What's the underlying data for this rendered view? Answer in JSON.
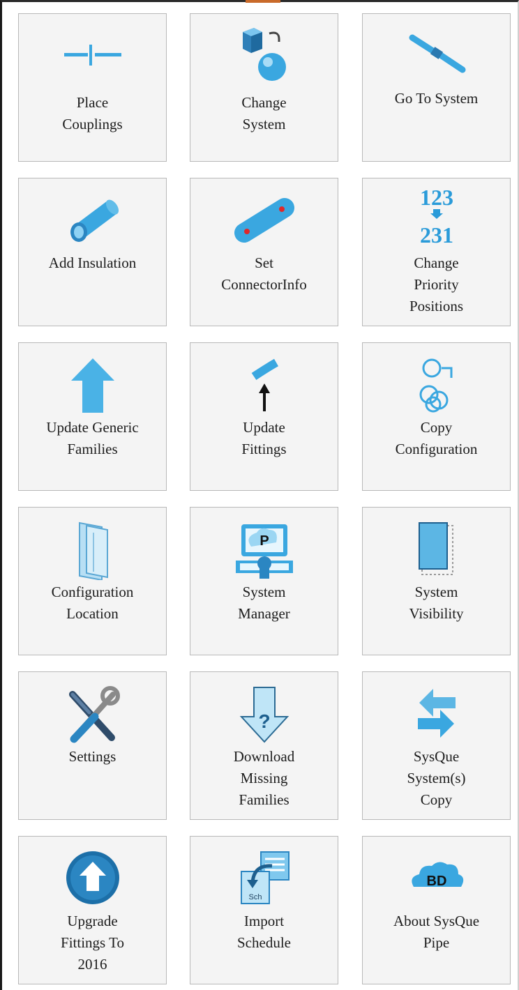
{
  "panel": {
    "tiles": [
      {
        "label": "Place\nCouplings",
        "icon": "place-couplings-icon"
      },
      {
        "label": "Change\nSystem",
        "icon": "change-system-icon"
      },
      {
        "label": "Go To System",
        "icon": "go-to-system-icon"
      },
      {
        "label": "Add Insulation",
        "icon": "add-insulation-icon"
      },
      {
        "label": "Set\nConnectorInfo",
        "icon": "set-connector-info-icon"
      },
      {
        "label": "Change\nPriority\nPositions",
        "icon": "change-priority-icon",
        "icon_text_top": "123",
        "icon_text_bottom": "231"
      },
      {
        "label": "Update Generic\nFamilies",
        "icon": "update-generic-families-icon"
      },
      {
        "label": "Update\nFittings",
        "icon": "update-fittings-icon"
      },
      {
        "label": "Copy\nConfiguration",
        "icon": "copy-configuration-icon"
      },
      {
        "label": "Configuration\nLocation",
        "icon": "configuration-location-icon"
      },
      {
        "label": "System\nManager",
        "icon": "system-manager-icon",
        "icon_text": "P"
      },
      {
        "label": "System\nVisibility",
        "icon": "system-visibility-icon"
      },
      {
        "label": "Settings",
        "icon": "settings-icon"
      },
      {
        "label": "Download\nMissing\nFamilies",
        "icon": "download-missing-families-icon"
      },
      {
        "label": "SysQue\nSystem(s)\nCopy",
        "icon": "sysque-systems-copy-icon"
      },
      {
        "label": "Upgrade\nFittings To\n2016",
        "icon": "upgrade-fittings-icon"
      },
      {
        "label": "Import\nSchedule",
        "icon": "import-schedule-icon",
        "icon_text": "Sch"
      },
      {
        "label": "About SysQue\nPipe",
        "icon": "about-sysque-pipe-icon",
        "icon_text": "BD"
      }
    ]
  },
  "colors": {
    "tile_bg": "#f4f4f4",
    "tile_border": "#b8b8b8",
    "icon_blue": "#3aa7e0",
    "icon_dark_blue": "#1c6fa8"
  }
}
